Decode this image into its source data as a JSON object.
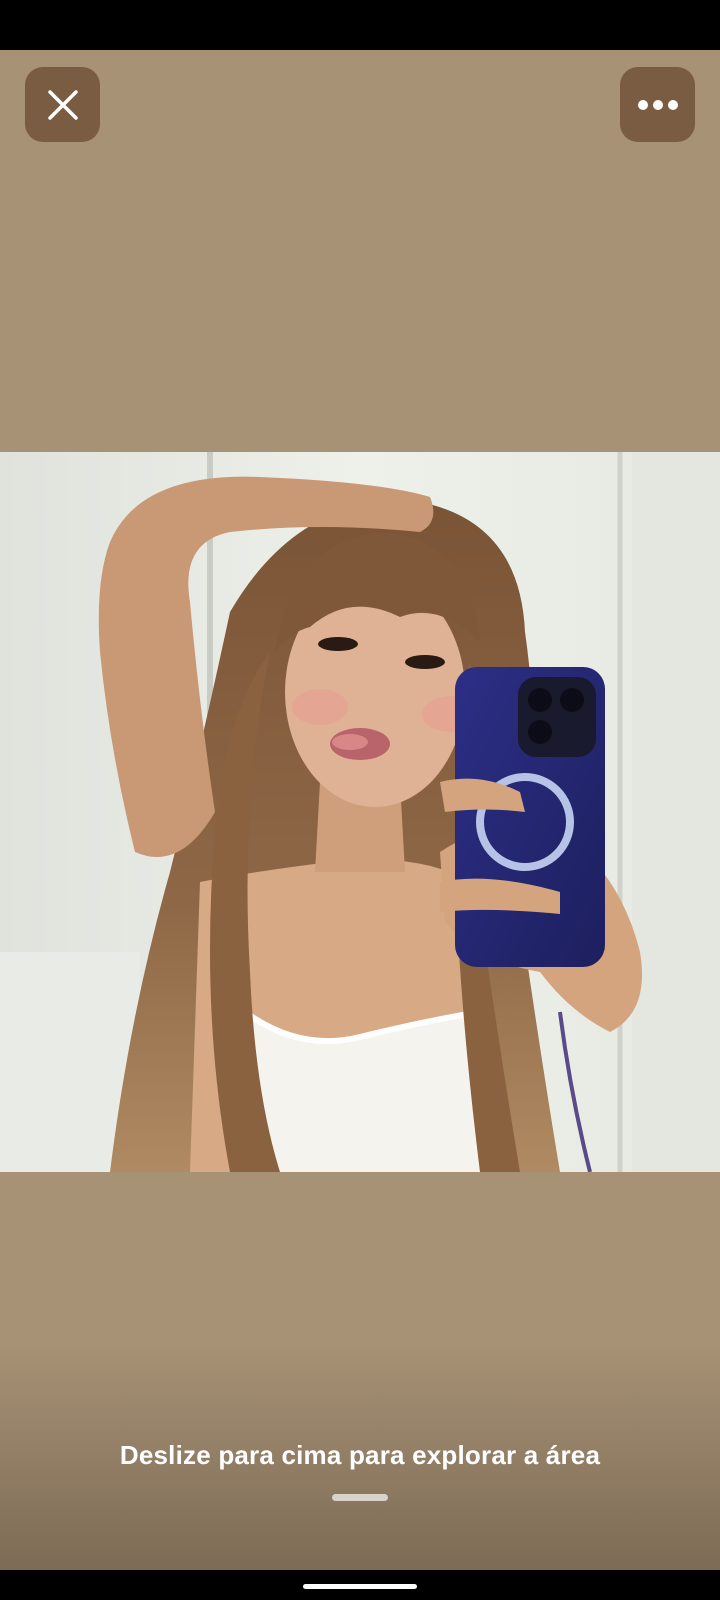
{
  "toolbar": {
    "close_icon": "close-icon",
    "more_icon": "more-horizontal-icon"
  },
  "photo": {
    "subject": "mirror-selfie-photo"
  },
  "hint": {
    "text": "Deslize para cima para explorar a área"
  },
  "colors": {
    "background": "#a79275",
    "button": "#7a5c42",
    "text": "#ffffff"
  }
}
